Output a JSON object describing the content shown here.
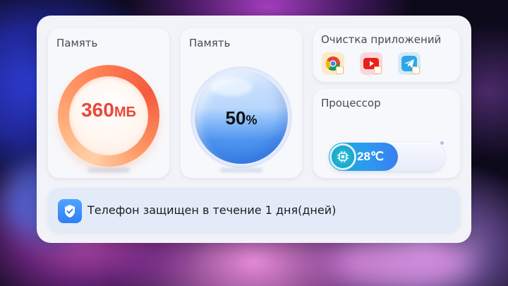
{
  "memory_ring": {
    "title": "Память",
    "value": "360",
    "unit": "МБ"
  },
  "memory_sphere": {
    "title": "Память",
    "value": "50",
    "unit": "%",
    "fill_fraction": 0.5
  },
  "app_cleanup": {
    "title": "Очистка приложений",
    "apps": [
      {
        "name": "chrome-icon"
      },
      {
        "name": "youtube-icon"
      },
      {
        "name": "telegram-icon"
      }
    ]
  },
  "cpu": {
    "title": "Процессор",
    "temperature": "28℃",
    "fill_fraction": 0.6
  },
  "protection": {
    "text": "Телефон защищен в течение 1 дня(дней)"
  },
  "colors": {
    "ring_value": "#e8493a",
    "sphere_blue": "#3d86ea",
    "temp_fill": "#2c9af0",
    "shield": "#2d7ff5"
  }
}
